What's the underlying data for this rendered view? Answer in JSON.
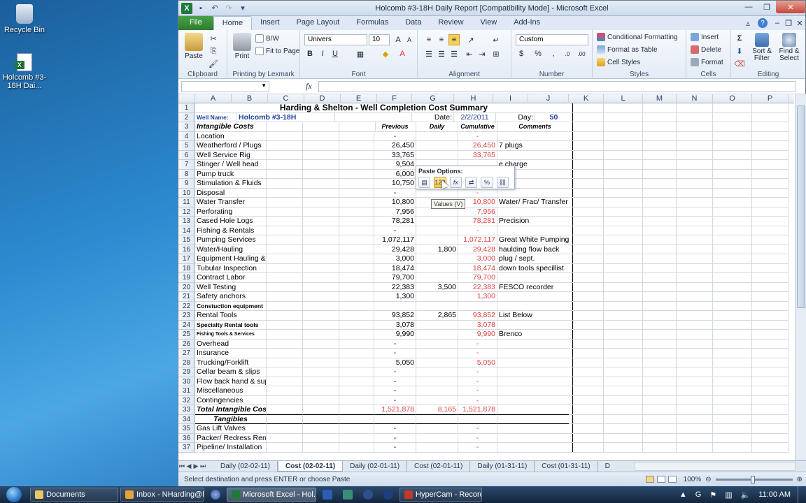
{
  "desktop": {
    "icons": [
      {
        "label": "Recycle Bin"
      },
      {
        "label": "Holcomb #3-18H Dai..."
      }
    ]
  },
  "taskbar": {
    "items": [
      "Documents",
      "Inbox - NHarding@h...",
      "Microsoft Excel - Hol...",
      "HyperCam - Recordi..."
    ],
    "clock": "11:00 AM",
    "tray_g": "G"
  },
  "window": {
    "title": "Holcomb #3-18H Daily Report  [Compatibility Mode]  -  Microsoft Excel"
  },
  "ribbon": {
    "tabs": [
      "File",
      "Home",
      "Insert",
      "Page Layout",
      "Formulas",
      "Data",
      "Review",
      "View",
      "Add-Ins"
    ],
    "groups": {
      "clipboard": "Clipboard",
      "printing": "Printing by Lexmark",
      "font": "Font",
      "alignment": "Alignment",
      "number": "Number",
      "styles": "Styles",
      "cells": "Cells",
      "editing": "Editing"
    },
    "paste": "Paste",
    "print": "Print",
    "bw": "B/W",
    "fit_to_page": "Fit to Page",
    "font_name": "Univers",
    "font_size": "10",
    "number_format": "Custom",
    "conditional_formatting": "Conditional Formatting",
    "format_as_table": "Format as Table",
    "cell_styles": "Cell Styles",
    "insert": "Insert",
    "delete": "Delete",
    "format": "Format",
    "sort_filter": "Sort & Filter",
    "find_select": "Find & Select"
  },
  "formula_bar": {
    "fx": "fx",
    "value": ""
  },
  "columns": [
    "A",
    "B",
    "C",
    "D",
    "E",
    "F",
    "G",
    "H",
    "I",
    "J",
    "K",
    "L",
    "M",
    "N",
    "O",
    "P"
  ],
  "sheet": {
    "title": "Harding & Shelton  -  Well Completion Cost Summary",
    "well_name_label": "Well Name:",
    "well_name": "Holcomb #3-18H",
    "date_label": "Date:",
    "date": "2/2/2011",
    "day_label": "Day:",
    "day": "50",
    "headers": {
      "a": "Intangible Costs",
      "f": "Previous",
      "g": "Daily",
      "h": "Cumulative",
      "i": "Comments"
    },
    "rows": [
      {
        "n": "4",
        "a": "Location",
        "f": "-",
        "g": "",
        "h": "-",
        "i": ""
      },
      {
        "n": "5",
        "a": "Weatherford / Plugs",
        "f": "26,450",
        "g": "",
        "h": "26,450",
        "i": "7 plugs"
      },
      {
        "n": "6",
        "a": "Well Service Rig",
        "f": "33,765",
        "g": "",
        "h": "33,765",
        "i": ""
      },
      {
        "n": "7",
        "a": "Stinger / Well head",
        "f": "9,504",
        "g": "",
        "h": "",
        "i": "e charge"
      },
      {
        "n": "8",
        "a": "Pump truck",
        "f": "6,000",
        "g": "",
        "h": "",
        "i": ""
      },
      {
        "n": "9",
        "a": "Stimulation & Fluids",
        "f": "10,750",
        "g": "",
        "h": "",
        "i": ""
      },
      {
        "n": "10",
        "a": "Disposal",
        "f": "-",
        "g": "",
        "h": "-",
        "i": ""
      },
      {
        "n": "11",
        "a": "Water Transfer",
        "f": "10,800",
        "g": "",
        "h": "10,800",
        "i": "Water/ Frac/ Transfer"
      },
      {
        "n": "12",
        "a": "Perforating",
        "f": "7,956",
        "g": "",
        "h": "7,956",
        "i": ""
      },
      {
        "n": "13",
        "a": "Cased Hole Logs",
        "f": "78,281",
        "g": "",
        "h": "78,281",
        "i": "Precision"
      },
      {
        "n": "14",
        "a": "Fishing & Rentals",
        "f": "-",
        "g": "",
        "h": "-",
        "i": ""
      },
      {
        "n": "15",
        "a": "Pumping Services",
        "f": "1,072,117",
        "g": "",
        "h": "1,072,117",
        "i": "Great White Pumping"
      },
      {
        "n": "16",
        "a": "Water/Hauling",
        "f": "29,428",
        "g": "1,800",
        "h": "29,428",
        "i": "haulding flow back"
      },
      {
        "n": "17",
        "a": "Equipment Hauling &",
        "f": "3,000",
        "g": "",
        "h": "3,000",
        "i": "plug / sept."
      },
      {
        "n": "18",
        "a": "Tubular Inspection",
        "f": "18,474",
        "g": "",
        "h": "18,474",
        "i": "down tools specillist"
      },
      {
        "n": "19",
        "a": "Contract Labor",
        "f": "79,700",
        "g": "",
        "h": "79,700",
        "i": ""
      },
      {
        "n": "20",
        "a": "Well Testing",
        "f": "22,383",
        "g": "3,500",
        "h": "22,383",
        "i": "FESCO recorder"
      },
      {
        "n": "21",
        "a": "Safety anchors",
        "f": "1,300",
        "g": "",
        "h": "1,300",
        "i": ""
      },
      {
        "n": "22",
        "a": "Constuction equipment",
        "f": "",
        "g": "",
        "h": "",
        "i": "",
        "style": "bold small"
      },
      {
        "n": "23",
        "a": "Rental Tools",
        "f": "93,852",
        "g": "2,865",
        "h": "93,852",
        "i": "List Below"
      },
      {
        "n": "24",
        "a": "Specialty Rental tools",
        "f": "3,078",
        "g": "",
        "h": "3,078",
        "i": "",
        "style": "bold small"
      },
      {
        "n": "25",
        "a": "Fishing Tools & Services",
        "f": "9,990",
        "g": "",
        "h": "9,990",
        "i": "Brenco",
        "style": "bold tiny"
      },
      {
        "n": "26",
        "a": "Overhead",
        "f": "-",
        "g": "",
        "h": "-",
        "i": ""
      },
      {
        "n": "27",
        "a": "Insurance",
        "f": "-",
        "g": "",
        "h": "-",
        "i": ""
      },
      {
        "n": "28",
        "a": "Trucking/Forklift",
        "f": "5,050",
        "g": "",
        "h": "5,050",
        "i": ""
      },
      {
        "n": "29",
        "a": "Cellar beam & slips",
        "f": "-",
        "g": "",
        "h": "-",
        "i": ""
      },
      {
        "n": "30",
        "a": "Flow back hand & sup",
        "f": "-",
        "g": "",
        "h": "-",
        "i": ""
      },
      {
        "n": "31",
        "a": "Miscellaneous",
        "f": "-",
        "g": "",
        "h": "-",
        "i": ""
      },
      {
        "n": "32",
        "a": "Contingencies",
        "f": "-",
        "g": "",
        "h": "-",
        "i": ""
      },
      {
        "n": "33",
        "a": "Total Intangible Cos",
        "f": "1,521,878",
        "g": "8,165",
        "h": "1,521,878",
        "i": "",
        "style": "total"
      },
      {
        "n": "34",
        "a": "Tangibles",
        "f": "",
        "g": "",
        "h": "",
        "i": "",
        "style": "section"
      },
      {
        "n": "35",
        "a": " Gas Lift Valves",
        "f": "-",
        "g": "",
        "h": "-",
        "i": ""
      },
      {
        "n": "36",
        "a": "Packer/ Redress Ren",
        "f": "-",
        "g": "",
        "h": "-",
        "i": ""
      },
      {
        "n": "37",
        "a": "Pipeline/ Installation",
        "f": "-",
        "g": "",
        "h": "-",
        "i": ""
      }
    ]
  },
  "paste_options": {
    "title": "Paste Options:",
    "tooltip": "Values (V)"
  },
  "sheet_tabs": [
    "Daily (02-02-11)",
    "Cost (02-02-11)",
    "Daily (02-01-11)",
    "Cost (02-01-11)",
    "Daily (01-31-11)",
    "Cost (01-31-11)",
    "D"
  ],
  "statusbar": {
    "message": "Select destination and press ENTER or choose Paste",
    "zoom": "100%"
  }
}
